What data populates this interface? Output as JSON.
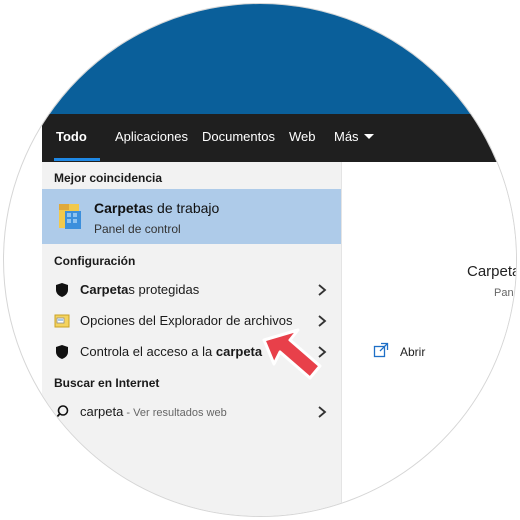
{
  "tabs": [
    {
      "label": "Todo"
    },
    {
      "label": "Aplicaciones"
    },
    {
      "label": "Documentos"
    },
    {
      "label": "Web"
    },
    {
      "label": "Más"
    }
  ],
  "best_match": {
    "section": "Mejor coincidencia",
    "title_bold": "Carpeta",
    "title_rest": "s de trabajo",
    "subtitle": "Panel de control"
  },
  "settings": {
    "section": "Configuración",
    "items": [
      {
        "bold": "Carpeta",
        "rest": "s protegidas",
        "icon": "shield-icon"
      },
      {
        "text": "Opciones del Explorador de archivos",
        "icon": "folder-options-icon"
      },
      {
        "prefix": "Controla el acceso a la ",
        "bold": "carpeta",
        "icon": "shield-icon"
      }
    ]
  },
  "internet": {
    "section": "Buscar en Internet",
    "query": "carpeta",
    "suffix": " - Ver resultados web",
    "icon": "search-icon"
  },
  "preview": {
    "title": "Carpeta",
    "subtitle": "Pane",
    "open_label": "Abrir"
  },
  "colors": {
    "accent": "#1e88e5",
    "selected": "#aecbe9",
    "wallpaper": "#0a5f9a",
    "arrow": "#e8404a"
  }
}
